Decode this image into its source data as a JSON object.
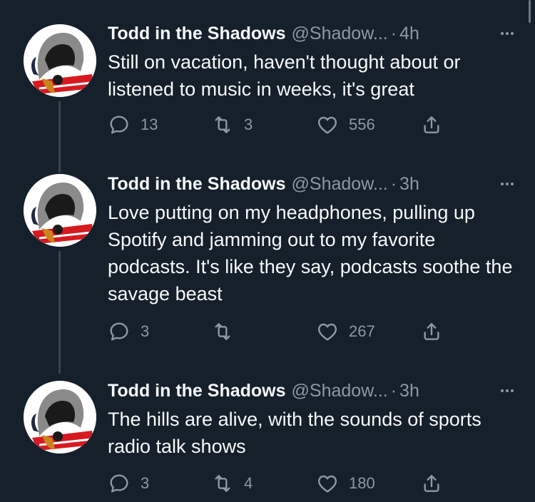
{
  "tweets": [
    {
      "name": "Todd in the Shadows",
      "handle": "@Shadow...",
      "separator": "·",
      "time": "4h",
      "text": "Still on vacation, haven't thought about or listened to music in weeks, it's great",
      "replies": "13",
      "retweets": "3",
      "likes": "556"
    },
    {
      "name": "Todd in the Shadows",
      "handle": "@Shadow...",
      "separator": "·",
      "time": "3h",
      "text": "Love putting on my headphones, pulling up Spotify and jamming out to my favorite podcasts. It's like they say, podcasts soothe the savage beast",
      "replies": "3",
      "retweets": "",
      "likes": "267"
    },
    {
      "name": "Todd in the Shadows",
      "handle": "@Shadow...",
      "separator": "·",
      "time": "3h",
      "text": "The hills are alive, with the sounds of sports radio talk shows",
      "replies": "3",
      "retweets": "4",
      "likes": "180"
    }
  ],
  "colors": {
    "background": "#15202b",
    "primary_text": "#f7f9f9",
    "secondary_text": "#8b98a5",
    "thread_line": "#38444d"
  },
  "icons": {
    "reply": "reply-icon",
    "retweet": "retweet-icon",
    "like": "heart-icon",
    "share": "share-icon",
    "more": "more-icon"
  }
}
